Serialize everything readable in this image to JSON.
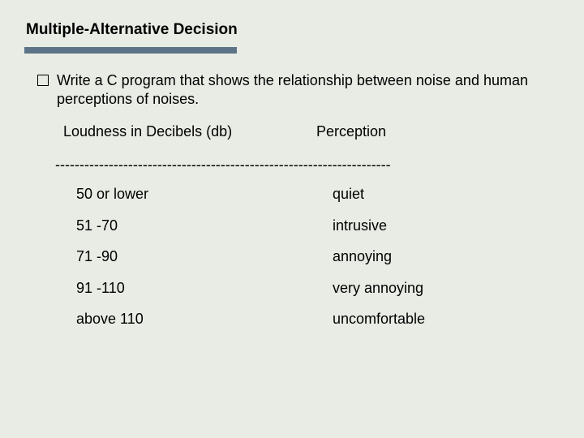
{
  "title": "Multiple-Alternative Decision",
  "bullet": "Write a C program that shows the relationship between noise and human perceptions of noises.",
  "headers": {
    "left": "Loudness in Decibels (db)",
    "right": "Perception"
  },
  "divider": "---------------------------------------------------------------------",
  "rows": [
    {
      "range": "50 or lower",
      "perception": "quiet"
    },
    {
      "range": "51 -70",
      "perception": "intrusive"
    },
    {
      "range": "71 -90",
      "perception": "annoying"
    },
    {
      "range": "91 -110",
      "perception": "very annoying"
    },
    {
      "range": "above 110",
      "perception": " uncomfortable"
    }
  ]
}
